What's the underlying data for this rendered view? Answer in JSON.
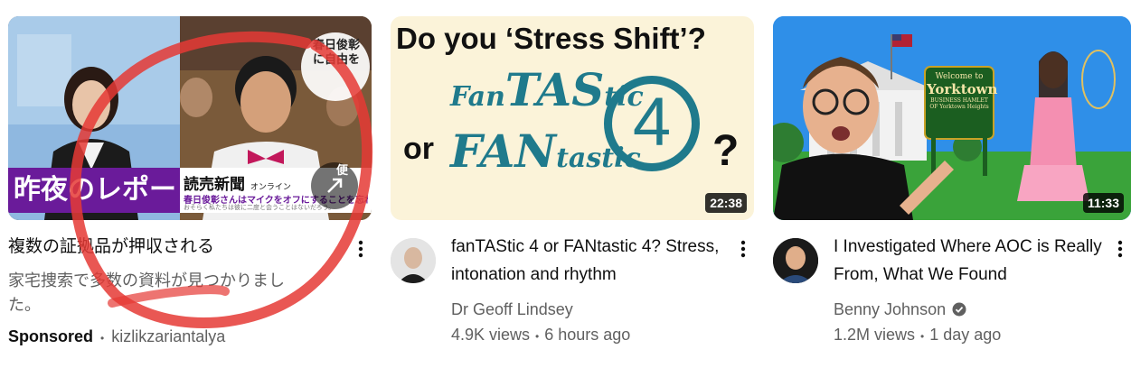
{
  "ad": {
    "thumb_headline": "昨夜のレポー",
    "thumb_corner_text": "春日俊彰に自由を",
    "thumb_news_logo": "読売新聞",
    "thumb_news_sub": "オンライン",
    "thumb_caption": "春日俊彰さんはマイクをオフにすることを忘れた。",
    "thumb_caption_small": "おそらく私たちは彼に二度と会うことはないだろう。",
    "thumb_button": "便",
    "title": "複数の証拠品が押収される",
    "description": "家宅捜索で多数の資料が見つかりました。",
    "sponsored_label": "Sponsored",
    "advertiser": "kizlikzariantalya"
  },
  "videos": [
    {
      "thumb_line1": "Do you ‘Stress Shift’?",
      "thumb_word1a": "Fan",
      "thumb_word1b": "TAS",
      "thumb_word1c": "tic",
      "thumb_or": "or",
      "thumb_word2a": "FAN",
      "thumb_word2b": "tastic",
      "thumb_number": "4",
      "thumb_q": "?",
      "duration": "22:38",
      "title": "fanTAStic 4 or FANtastic 4? Stress, intonation and rhythm",
      "channel": "Dr Geoff Lindsey",
      "views": "4.9K views",
      "age": "6 hours ago"
    },
    {
      "thumb_sign_top": "Welcome to",
      "thumb_sign_main": "Yorktown",
      "thumb_sign_sub": "BUSINESS HAMLET OF Yorktown Heights",
      "duration": "11:33",
      "title": "I Investigated Where AOC is Really From, What We Found",
      "channel": "Benny Johnson",
      "views": "1.2M views",
      "age": "1 day ago"
    }
  ],
  "separator": "•",
  "colors": {
    "ad_headline_bg": "#6a1b9a",
    "red_scribble": "#e53935",
    "thumb2_bg": "#fbf3d9",
    "thumb2_teal": "#1f7a8c",
    "thumb3_sky": "#1e88e5",
    "thumb3_grass": "#3aa33a",
    "verified": "#606060"
  }
}
